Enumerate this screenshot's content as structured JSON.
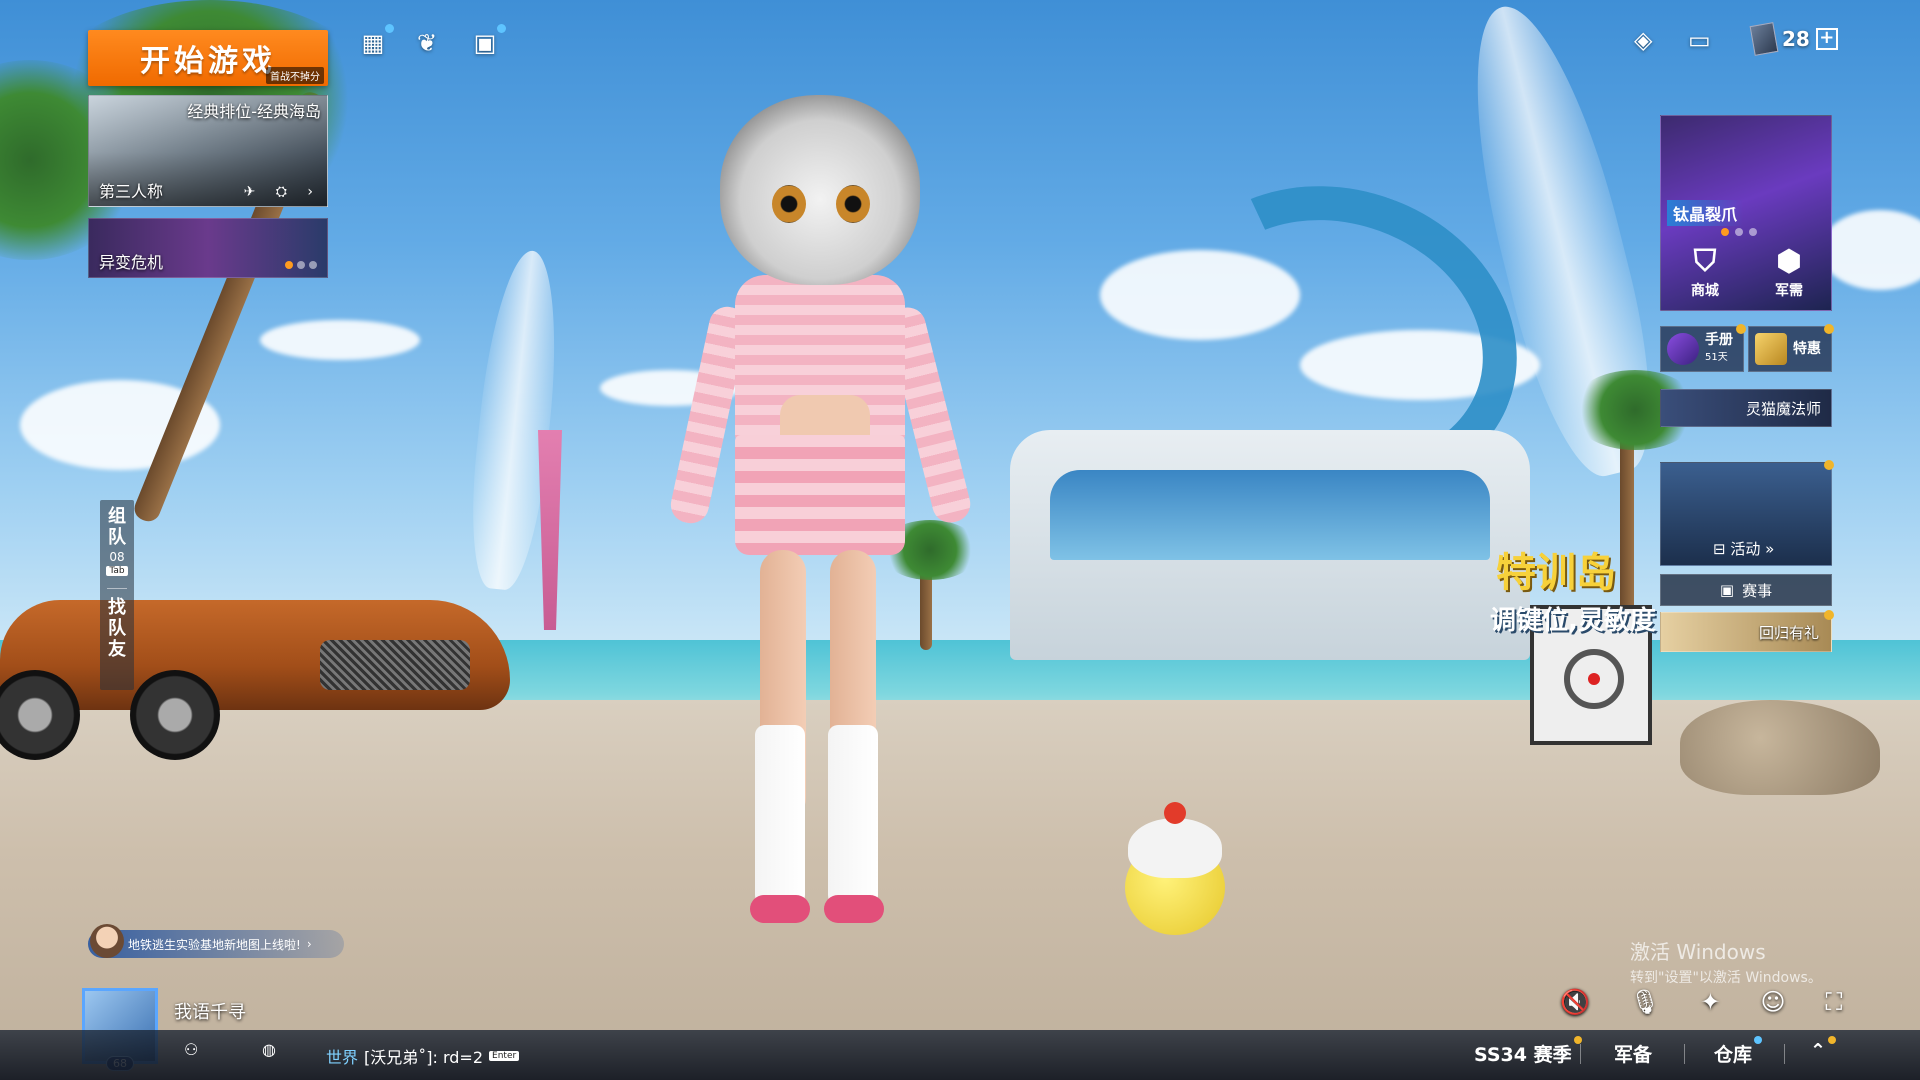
{
  "start": {
    "label": "开始游戏",
    "sublabel": "首战不掉分"
  },
  "mode": {
    "title": "经典排位-经典海岛",
    "perspective": "第三人称",
    "icons": "✈ ⛭ ›"
  },
  "event_mode": {
    "label": "异变危机"
  },
  "top_left_icons": [
    "grid-icon",
    "wings-icon",
    "task-icon"
  ],
  "side_tabs": {
    "team_label_1": "组",
    "team_label_2": "队",
    "team_count": "08",
    "team_key": "Tab",
    "find_1": "找",
    "find_2": "队",
    "find_3": "友"
  },
  "resources": {
    "ticket_count": "28",
    "plus": "+"
  },
  "promo": {
    "name": "钛晶裂爪",
    "shop": "商城",
    "armory": "军需"
  },
  "cards": {
    "handbook": {
      "label": "手册",
      "days": "51天"
    },
    "special": {
      "label": "特惠"
    },
    "banner": {
      "label": "灵猫魔法师"
    },
    "activity": {
      "label": "活动"
    },
    "events": {
      "label": "赛事"
    },
    "return_gift": {
      "label": "回归有礼"
    }
  },
  "scene_text": {
    "sign_title": "特训岛",
    "sign_sub": "调键位,灵敏度"
  },
  "news": {
    "text": "地铁逃生实验基地新地图上线啦!",
    "arrow": "›"
  },
  "player": {
    "name": "我语千寻",
    "level": "68"
  },
  "watermark": {
    "line1": "激活 Windows",
    "line2": "转到\"设置\"以激活 Windows。"
  },
  "chat": {
    "channel": "世界",
    "message": "[沃兄弟˚]: rd=2",
    "enter": "Enter"
  },
  "nav": {
    "season": "SS34 赛季",
    "armory": "军备",
    "warehouse": "仓库",
    "up": "⌃"
  },
  "colors": {
    "accent_orange": "#f06a00",
    "info_blue": "#5ec4ff",
    "gold": "#f0b52b"
  }
}
